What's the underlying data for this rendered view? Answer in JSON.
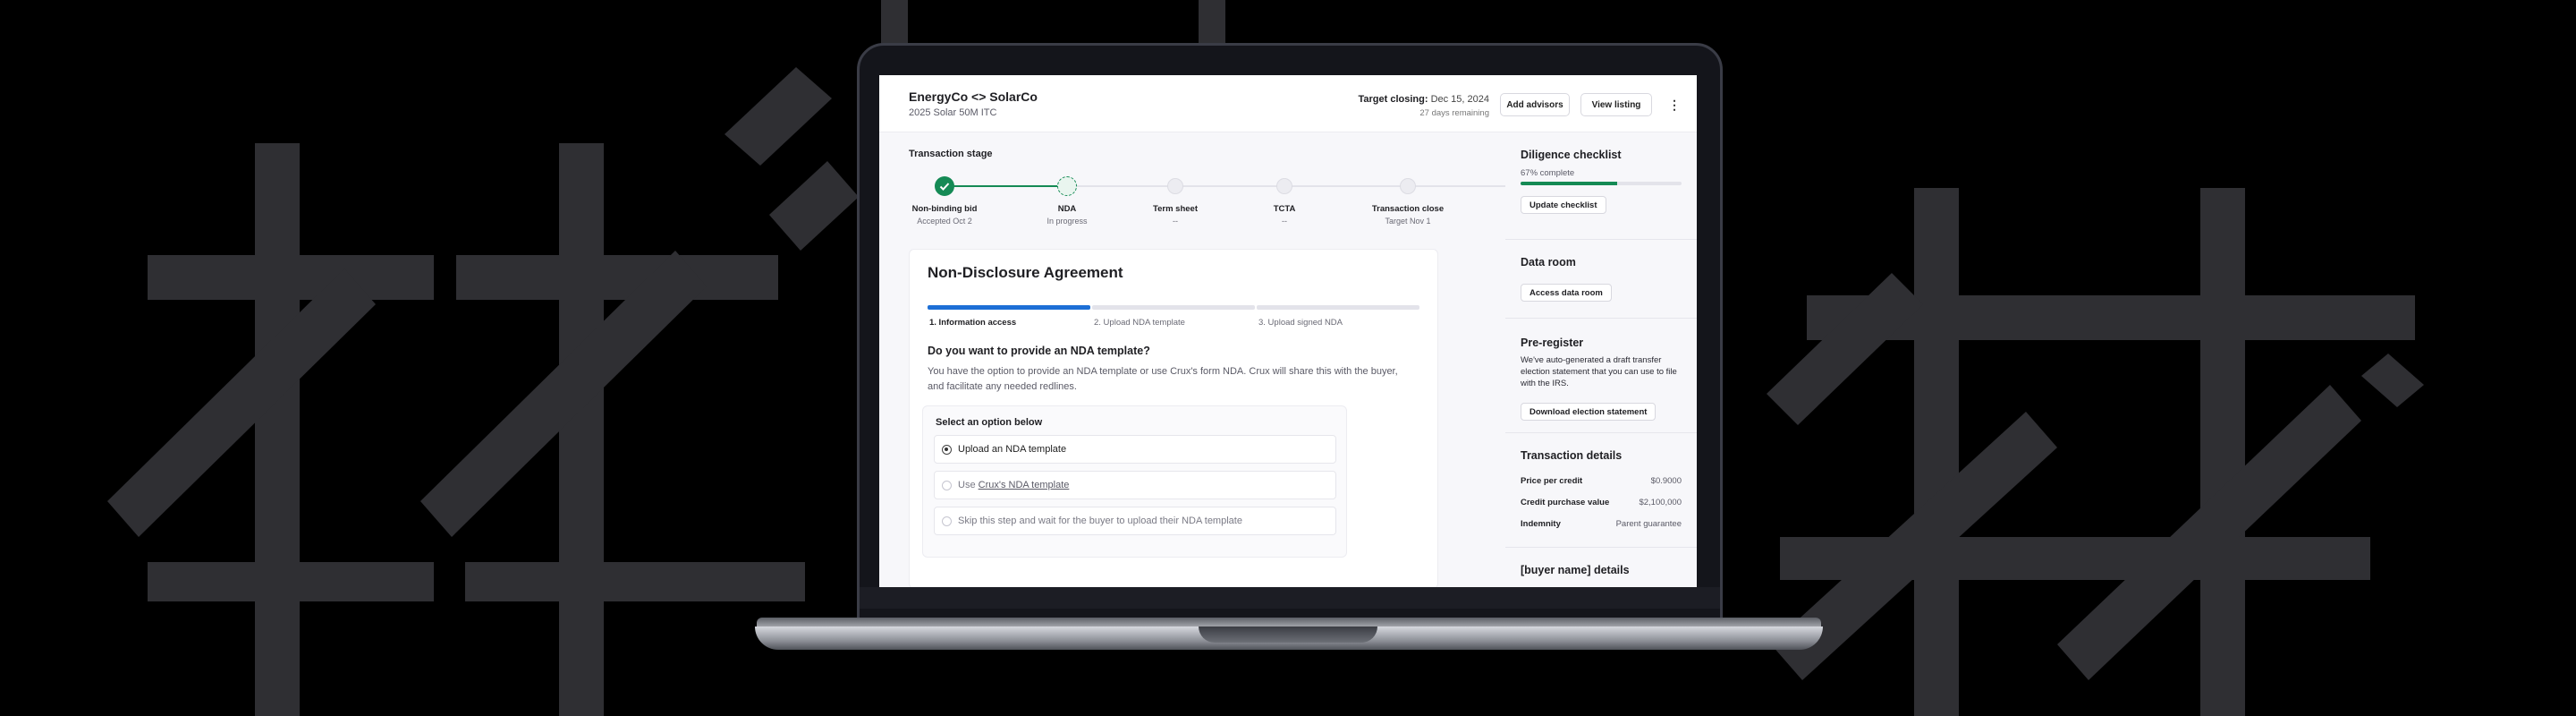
{
  "header": {
    "deal_title": "EnergyCo <> SolarCo",
    "deal_subtitle": "2025 Solar 50M ITC",
    "target_closing_label": "Target closing:",
    "target_closing_date": "Dec 15, 2024",
    "days_remaining": "27 days remaining",
    "add_advisors": "Add advisors",
    "view_listing": "View listing",
    "more": "⋮"
  },
  "stage": {
    "label": "Transaction stage",
    "steps": [
      {
        "name": "Non-binding bid",
        "sub": "Accepted Oct 2",
        "state": "done"
      },
      {
        "name": "NDA",
        "sub": "In progress",
        "state": "current"
      },
      {
        "name": "Term sheet",
        "sub": "--",
        "state": "todo"
      },
      {
        "name": "TCTA",
        "sub": "--",
        "state": "todo"
      },
      {
        "name": "Transaction close",
        "sub": "Target Nov 1",
        "state": "todo"
      }
    ]
  },
  "nda": {
    "title": "Non-Disclosure Agreement",
    "steps": [
      "1. Information access",
      "2. Upload NDA template",
      "3. Upload signed NDA"
    ],
    "question": "Do you want to provide an NDA template?",
    "description": "You have the option to provide an NDA template or use Crux's form NDA. Crux will share this with the buyer, and facilitate any needed redlines.",
    "options_title": "Select an option below",
    "option1": "Upload an NDA template",
    "option2_prefix": "Use ",
    "option2_link": "Crux's NDA template",
    "option3": "Skip this step and wait for the buyer to upload their NDA template"
  },
  "sidebar": {
    "checklist_title": "Diligence checklist",
    "checklist_progress": "67% complete",
    "checklist_fraction": 0.6,
    "checklist_button": "Update checklist",
    "dataroom_title": "Data room",
    "dataroom_button": "Access data room",
    "preregister_title": "Pre-register",
    "preregister_text": "We've auto-generated a draft transfer election statement that you can use to file with the IRS.",
    "preregister_button": "Download election statement",
    "details_title": "Transaction details",
    "details": [
      {
        "k": "Price per credit",
        "v": "$0.9000"
      },
      {
        "k": "Credit purchase value",
        "v": "$2,100,000"
      },
      {
        "k": "Indemnity",
        "v": "Parent guarantee"
      }
    ],
    "buyer_title": "[buyer name] details"
  },
  "colors": {
    "accent_blue": "#1d6fd6",
    "success_green": "#158a55"
  }
}
